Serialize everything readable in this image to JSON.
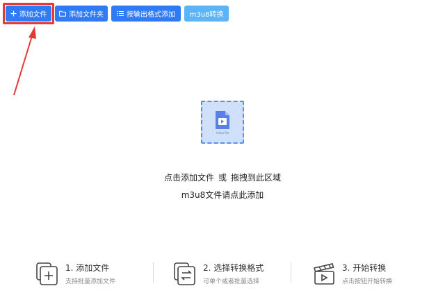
{
  "toolbar": {
    "add_file": "添加文件",
    "add_folder": "添加文件夹",
    "add_by_format": "按输出格式添加",
    "m3u8": "m3u8转换"
  },
  "drop_zone": {
    "icon_caption": "Video file",
    "hint_click": "点击添加文件",
    "hint_or": "或",
    "hint_drag": "拖拽到此区域",
    "hint_m3u8": "m3u8文件请点此添加"
  },
  "steps": [
    {
      "title": "1. 添加文件",
      "subtitle": "支持批量添加文件"
    },
    {
      "title": "2. 选择转换格式",
      "subtitle": "可单个或者批量选择"
    },
    {
      "title": "3. 开始转换",
      "subtitle": "点击按钮开始转换"
    }
  ],
  "colors": {
    "primary": "#2f7bf5",
    "secondary": "#5ab4f7",
    "highlight": "#e53935",
    "drop_bg": "#cfe0fb"
  }
}
